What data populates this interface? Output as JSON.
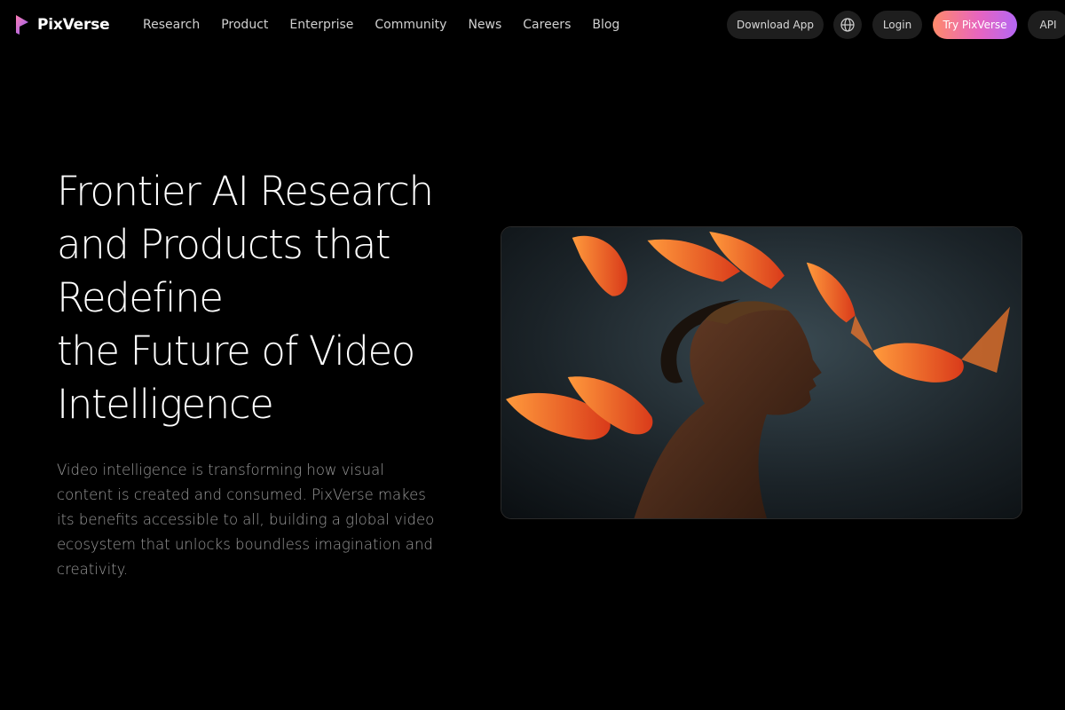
{
  "brand": {
    "name": "PixVerse"
  },
  "nav": {
    "items": [
      "Research",
      "Product",
      "Enterprise",
      "Community",
      "News",
      "Careers",
      "Blog"
    ]
  },
  "actions": {
    "download": "Download App",
    "globe_icon": "globe-icon",
    "login": "Login",
    "try": "Try PixVerse",
    "api": "API"
  },
  "hero": {
    "title_lines": [
      "Frontier AI Research",
      "and Products that",
      "Redefine",
      "the Future of Video",
      "Intelligence"
    ],
    "description": "Video intelligence is transforming how visual content is created and consumed. PixVerse makes its benefits accessible to all, building a global video ecosystem that unlocks boundless imagination and creativity."
  },
  "colors": {
    "background": "#000000",
    "accent_gradient_start": "#ff8a6b",
    "accent_gradient_end": "#b466f4",
    "pill_bg": "#1e1e1e"
  }
}
